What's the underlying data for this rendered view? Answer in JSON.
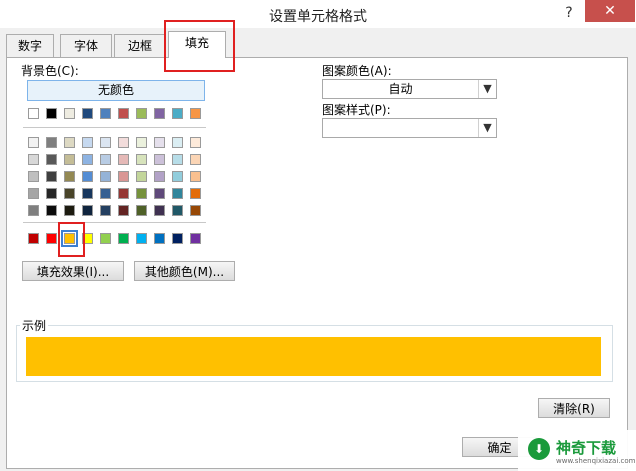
{
  "window": {
    "title": "设置单元格格式",
    "help_icon": "question-icon",
    "close_icon": "close-icon"
  },
  "tabs": [
    {
      "label": "数字"
    },
    {
      "label": "字体"
    },
    {
      "label": "边框"
    },
    {
      "label": "填充",
      "active": true
    }
  ],
  "fill": {
    "background_label": "背景色(C):",
    "no_color_label": "无颜色",
    "selected_color": "#ffc000",
    "palette_row_top": [
      "#ffffff",
      "#000000",
      "#eeece1",
      "#1f497d",
      "#4f81bd",
      "#c0504d",
      "#9bbb59",
      "#8064a2",
      "#4bacc6",
      "#f79646"
    ],
    "palette_rows_shades": [
      [
        "#f2f2f2",
        "#7f7f7f",
        "#ddd9c3",
        "#c6d9f0",
        "#dbe5f1",
        "#f2dcdb",
        "#ebf1dd",
        "#e5e0ec",
        "#dbeef3",
        "#fdeada"
      ],
      [
        "#d8d8d8",
        "#595959",
        "#c4bd97",
        "#8db3e2",
        "#b8cce4",
        "#e5b9b7",
        "#d7e3bc",
        "#ccc1d9",
        "#b7dde8",
        "#fbd5b5"
      ],
      [
        "#bfbfbf",
        "#3f3f3f",
        "#938953",
        "#548dd4",
        "#95b3d7",
        "#d99694",
        "#c3d69b",
        "#b2a2c7",
        "#92cddc",
        "#fac08f"
      ],
      [
        "#a5a5a5",
        "#262626",
        "#494429",
        "#17365d",
        "#366092",
        "#953734",
        "#76923c",
        "#5f497a",
        "#31859b",
        "#e36c09"
      ],
      [
        "#7f7f7f",
        "#0c0c0c",
        "#1d1b10",
        "#0f243e",
        "#244061",
        "#632423",
        "#4f6128",
        "#3f3151",
        "#205867",
        "#974806"
      ]
    ],
    "palette_standard": [
      "#c00000",
      "#ff0000",
      "#ffc000",
      "#ffff00",
      "#92d050",
      "#00b050",
      "#00b0f0",
      "#0070c0",
      "#002060",
      "#7030a0"
    ],
    "fill_effects_button": "填充效果(I)...",
    "more_colors_button": "其他颜色(M)...",
    "pattern_color_label": "图案颜色(A):",
    "pattern_color_value": "自动",
    "pattern_style_label": "图案样式(P):",
    "pattern_style_value": "",
    "sample_label": "示例",
    "clear_button": "清除(R)",
    "ok_button": "确定"
  },
  "watermark": {
    "text": "神奇下载",
    "url": "www.shenqixiazai.com"
  }
}
